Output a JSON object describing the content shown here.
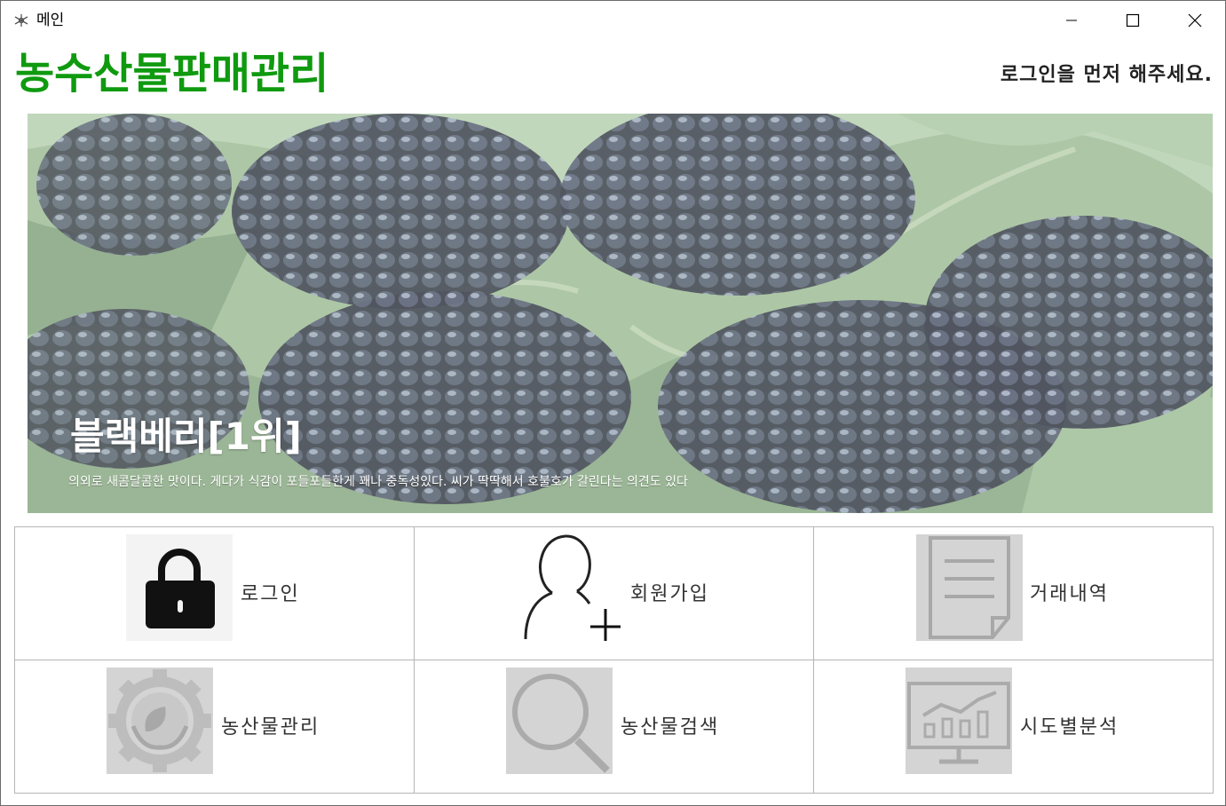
{
  "window": {
    "title": "메인",
    "icon": "snowflake-app-icon",
    "controls": [
      "minimize-icon",
      "maximize-icon",
      "close-icon"
    ]
  },
  "header": {
    "app_title": "농수산물판매관리",
    "login_status": "로그인을 먼저 해주세요.",
    "title_color": "#0f9a0f"
  },
  "banner": {
    "title": "블랙베리[1위]",
    "description": "의외로 새콤달콤한 맛이다. 게다가 식감이 포들포들한게 꽤나 중독성있다. 씨가 딱딱해서 호불호가 갈린다는 의견도 있다"
  },
  "menu": {
    "login": {
      "label": "로그인",
      "icon": "lock-icon"
    },
    "signup": {
      "label": "회원가입",
      "icon": "add-user-icon"
    },
    "transactions": {
      "label": "거래내역",
      "icon": "document-icon"
    },
    "produce_manage": {
      "label": "농산물관리",
      "icon": "gear-leaf-icon"
    },
    "produce_search": {
      "label": "농산물검색",
      "icon": "magnifier-icon"
    },
    "region_analysis": {
      "label": "시도별분석",
      "icon": "chart-board-icon"
    }
  }
}
